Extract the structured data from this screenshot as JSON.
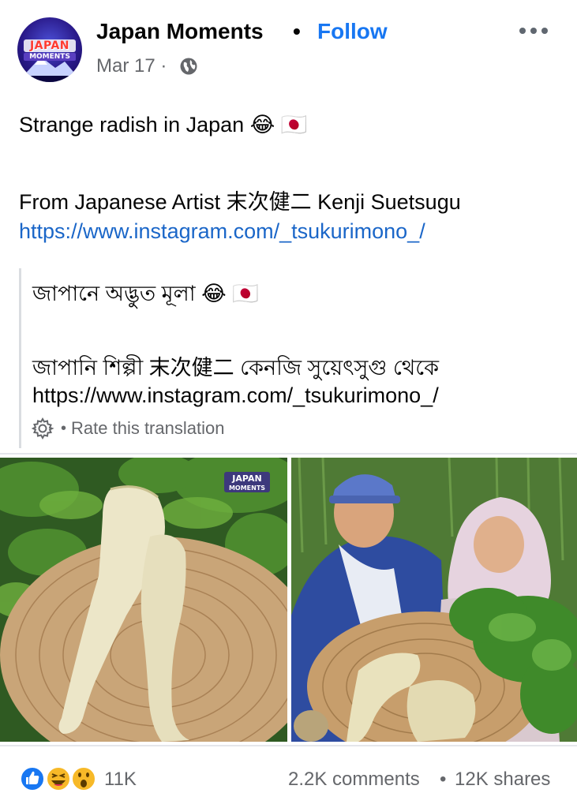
{
  "header": {
    "page_name": "Japan Moments",
    "separator": "•",
    "follow_label": "Follow",
    "date": "Mar 17 ·",
    "avatar_text_line1": "JAPAN",
    "avatar_text_line2": "MOMENTS"
  },
  "post": {
    "line1": "Strange radish in Japan 😂 🇯🇵",
    "line2": "From Japanese Artist 末次健二 Kenji Suetsugu",
    "link": "https://www.instagram.com/_tsukurimono_/"
  },
  "translation": {
    "line1": "জাপানে অদ্ভুত মূলা 😂 🇯🇵",
    "line2": "জাপানি শিল্পী 末次健二 কেনজি সুয়েৎসুগু থেকে",
    "link": "https://www.instagram.com/_tsukurimono_/",
    "bullet": "•",
    "rate_label": "Rate this translation"
  },
  "photos": {
    "watermark_line1": "JAPAN",
    "watermark_line2": "MOMENTS"
  },
  "footer": {
    "reaction_count": "11K",
    "comments": "2.2K comments",
    "separator": "•",
    "shares": "12K shares"
  },
  "colors": {
    "accent": "#1877f2",
    "link": "#1a66c8",
    "secondary_text": "#65676b",
    "like_blue": "#1877f2",
    "haha_yellow": "#f7b928"
  },
  "icons": [
    "more-icon",
    "globe-icon",
    "gear-icon",
    "like-reaction-icon",
    "haha-reaction-icon",
    "wow-reaction-icon"
  ]
}
